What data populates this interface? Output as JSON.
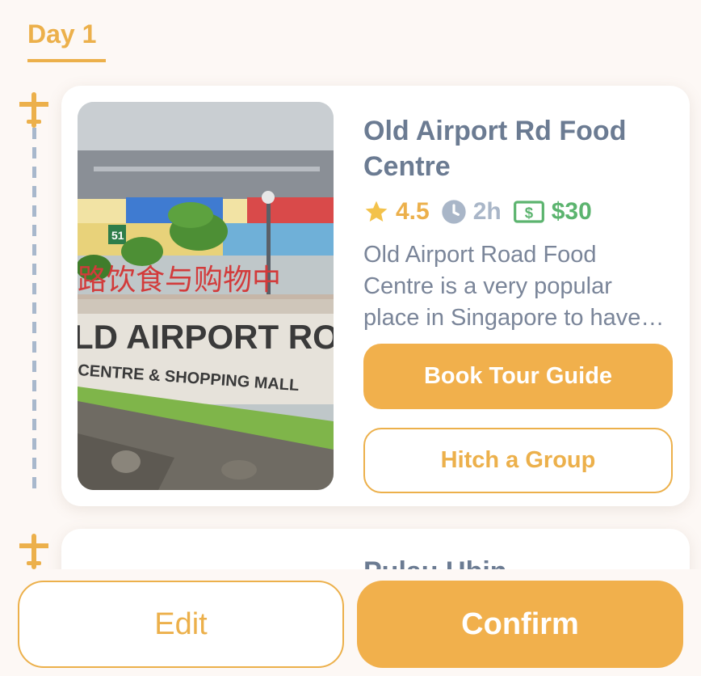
{
  "day_tab": {
    "label": "Day 1"
  },
  "itinerary": [
    {
      "title": "Old Airport Rd Food Centre",
      "rating": "4.5",
      "duration": "2h",
      "price": "$30",
      "description": "Old Airport Road Food Centre is a very popular place in Singapore to have local food and drinks.",
      "book_label": "Book Tour Guide",
      "hitch_label": "Hitch a Group",
      "photo": {
        "sign_line1": "LD AIRPORT ROAD",
        "sign_line2": "CENTRE & SHOPPING MALL",
        "chinese_sign": "路饮食与购物中",
        "block_number": "51"
      }
    },
    {
      "title": "Pulau Ubin"
    }
  ],
  "bottom_bar": {
    "edit_label": "Edit",
    "confirm_label": "Confirm"
  },
  "colors": {
    "accent": "#f1b04c",
    "title": "#6b7b92",
    "price": "#5cb46f",
    "muted": "#a9b6c8"
  },
  "icons": {
    "timeline": "airplane-icon",
    "rating": "star-icon",
    "duration": "clock-icon",
    "price": "dollar-bill-icon"
  }
}
